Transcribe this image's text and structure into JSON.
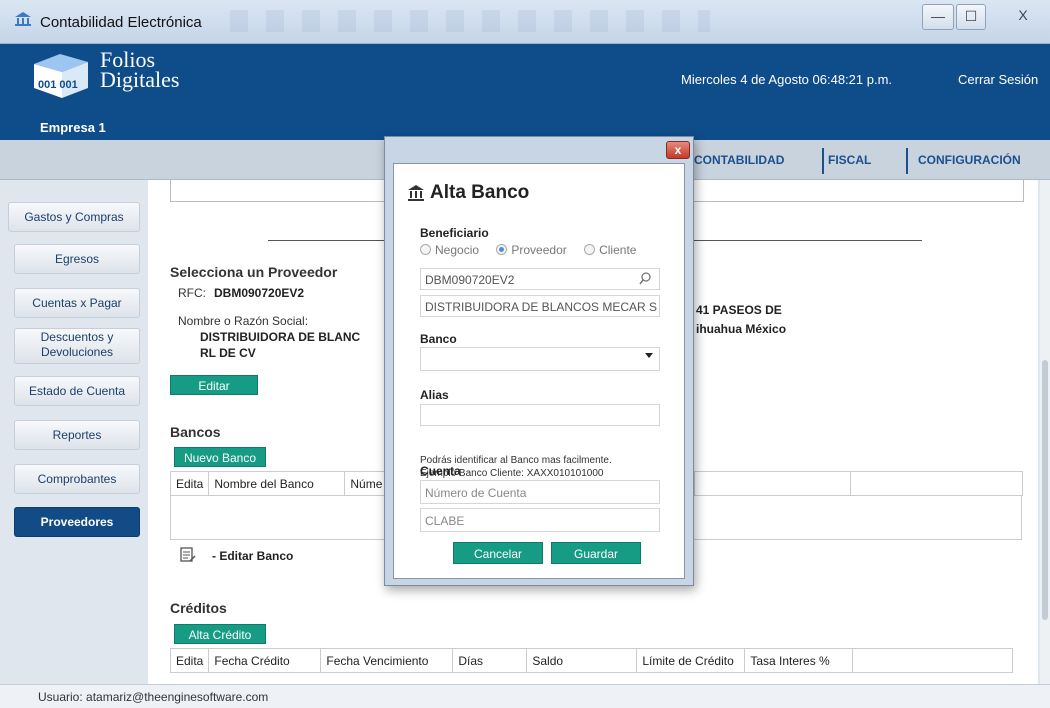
{
  "window": {
    "title": "Contabilidad Electrónica",
    "min_glyph": "—",
    "max_glyph": "☐",
    "close_glyph": "X"
  },
  "header": {
    "logo_line1": "Folios",
    "logo_line2": "Digitales",
    "logo_cube_text": "001 001",
    "company": "Empresa 1",
    "datetime": "Miercoles 4 de Agosto 06:48:21 p.m.",
    "logout": "Cerrar Sesión",
    "brand_color": "#0f4d8a"
  },
  "nav": {
    "items": [
      "CONTABILIDAD",
      "FISCAL",
      "CONFIGURACIÓN"
    ]
  },
  "sidebar": {
    "items": [
      {
        "label": "Gastos y Compras",
        "active": false
      },
      {
        "label": "Egresos",
        "active": false
      },
      {
        "label": "Cuentas x Pagar",
        "active": false
      },
      {
        "label": "Descuentos y Devoluciones",
        "active": false
      },
      {
        "label": "Estado de Cuenta",
        "active": false
      },
      {
        "label": "Reportes",
        "active": false
      },
      {
        "label": "Comprobantes",
        "active": false
      },
      {
        "label": "Proveedores",
        "active": true
      }
    ]
  },
  "proveedor": {
    "heading": "Selecciona un Proveedor",
    "rfc_label": "RFC:",
    "rfc_value": "DBM090720EV2",
    "name_label": "Nombre o Razón Social:",
    "name_line1": "DISTRIBUIDORA DE BLANC",
    "name_line2": "RL DE CV",
    "address_line1": "41 PASEOS DE",
    "address_line2": "ihuahua México",
    "edit_button": "Editar"
  },
  "bancos": {
    "heading": "Bancos",
    "new_button": "Nuevo Banco",
    "columns": [
      "Edita",
      "Nombre del Banco",
      "Núme"
    ],
    "edit_hint": "- Editar Banco"
  },
  "creditos": {
    "heading": "Créditos",
    "new_button": "Alta Crédito",
    "columns": [
      "Edita",
      "Fecha Crédito",
      "Fecha Vencimiento",
      "Días",
      "Saldo",
      "Límite de Crédito",
      "Tasa Interes %"
    ]
  },
  "status": {
    "user": "Usuario: atamariz@theenginesoftware.com"
  },
  "modal": {
    "title": "Alta Banco",
    "close_glyph": "x",
    "beneficiario_label": "Beneficiario",
    "radio_options": [
      {
        "label": "Negocio",
        "selected": false
      },
      {
        "label": "Proveedor",
        "selected": true
      },
      {
        "label": "Cliente",
        "selected": false
      }
    ],
    "rfc_value": "DBM090720EV2",
    "name_value": "DISTRIBUIDORA DE BLANCOS MECAR S",
    "banco_label": "Banco",
    "banco_value": "",
    "alias_label": "Alias",
    "alias_value": "",
    "hint_line1": "Podrás identificar al Banco mas facilmente.",
    "hint_line2": "Ejemplo Banco Cliente: XAXX010101000",
    "cuenta_label": "Cuenta",
    "cuenta_placeholder": "Número de Cuenta",
    "clabe_placeholder": "CLABE",
    "cancel_button": "Cancelar",
    "save_button": "Guardar",
    "accent_color": "#169b84"
  }
}
